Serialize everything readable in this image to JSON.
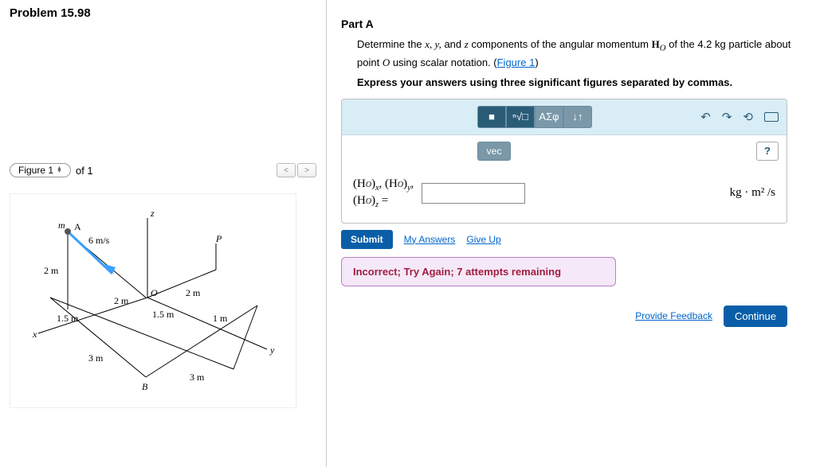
{
  "problem": {
    "title": "Problem 15.98"
  },
  "figure": {
    "label": "Figure 1",
    "count_text": "of 1",
    "labels": {
      "m": "m",
      "A": "A",
      "v": "6 m/s",
      "h": "2 m",
      "x2a": "2 m",
      "x2b": "2 m",
      "y15a": "1.5 m",
      "y15b": "1.5 m",
      "z1": "1 m",
      "x3": "3 m",
      "y3": "3 m",
      "B": "B",
      "O": "O",
      "P": "P",
      "x": "x",
      "y": "y",
      "z": "z"
    }
  },
  "part": {
    "title": "Part A",
    "prompt_pre": "Determine the ",
    "prompt_vars": "x, y,",
    "prompt_mid": " and ",
    "prompt_var_z": "z",
    "prompt_post1": " components of the angular momentum ",
    "prompt_HO": "H",
    "prompt_O": "O",
    "prompt_post2": " of the 4.2  kg particle about point ",
    "prompt_Opt": "O",
    "prompt_post3": " using scalar notation. (",
    "figure_link": "Figure 1",
    "prompt_post4": ")",
    "instruction": "Express your answers using three significant figures separated by commas."
  },
  "toolbar": {
    "templates": "■",
    "root": "ⁿ√□",
    "greek": "ΑΣφ",
    "subsup": "↓↑",
    "undo": "↶",
    "redo": "↷",
    "reset": "⟲",
    "keyboard": "kbd",
    "vec": "vec",
    "help": "?"
  },
  "input": {
    "lhs_line1a": "(H",
    "lhs_line1a_sub": "O",
    "lhs_line1a_close": ")",
    "lhs_x": "x",
    "lhs_comma": ", ",
    "lhs_line1b": "(H",
    "lhs_line1b_sub": "O",
    "lhs_line1b_close": ")",
    "lhs_y": "y",
    "lhs_line2": "(H",
    "lhs_line2_sub": "O",
    "lhs_line2_close": ")",
    "lhs_z": "z",
    "lhs_eq": " =",
    "value": "",
    "units": "kg · m² /s"
  },
  "actions": {
    "submit": "Submit",
    "my_answers": "My Answers",
    "give_up": "Give Up"
  },
  "feedback": {
    "message": "Incorrect; Try Again; 7 attempts remaining"
  },
  "footer": {
    "provide_feedback": "Provide Feedback",
    "continue": "Continue"
  }
}
